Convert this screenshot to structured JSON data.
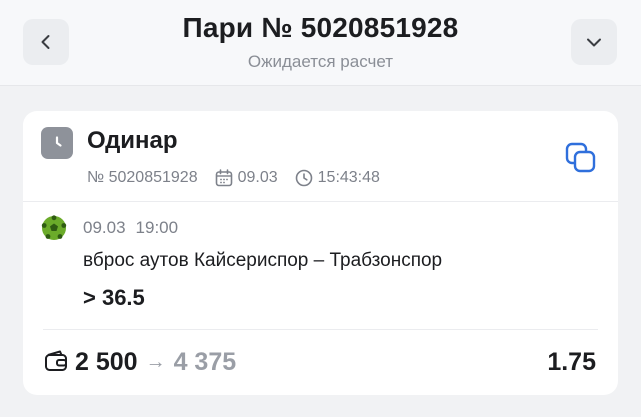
{
  "header": {
    "title": "Пари № 5020851928",
    "subtitle": "Ожидается расчет",
    "back_icon": "chevron-left-icon",
    "expand_icon": "chevron-down-icon"
  },
  "bet": {
    "type_icon": "clock-icon",
    "type": "Одинар",
    "number": "№ 5020851928",
    "date": "09.03",
    "time": "15:43:48",
    "copy_icon": "copy-icon"
  },
  "event": {
    "sport_icon": "football-icon",
    "date": "09.03",
    "time": "19:00",
    "market": "вброс аутов Кайсериспор – Трабзонспор",
    "outcome": "> 36.5"
  },
  "footer": {
    "stake_icon": "wallet-icon",
    "stake": "2 500",
    "arrow": "→",
    "payout": "4 375",
    "odds": "1.75"
  },
  "colors": {
    "background": "#f1f2f4",
    "card": "#ffffff",
    "accent_blue": "#2f6fdc",
    "muted": "#7d818a",
    "sport_green": "#6bab2a"
  }
}
